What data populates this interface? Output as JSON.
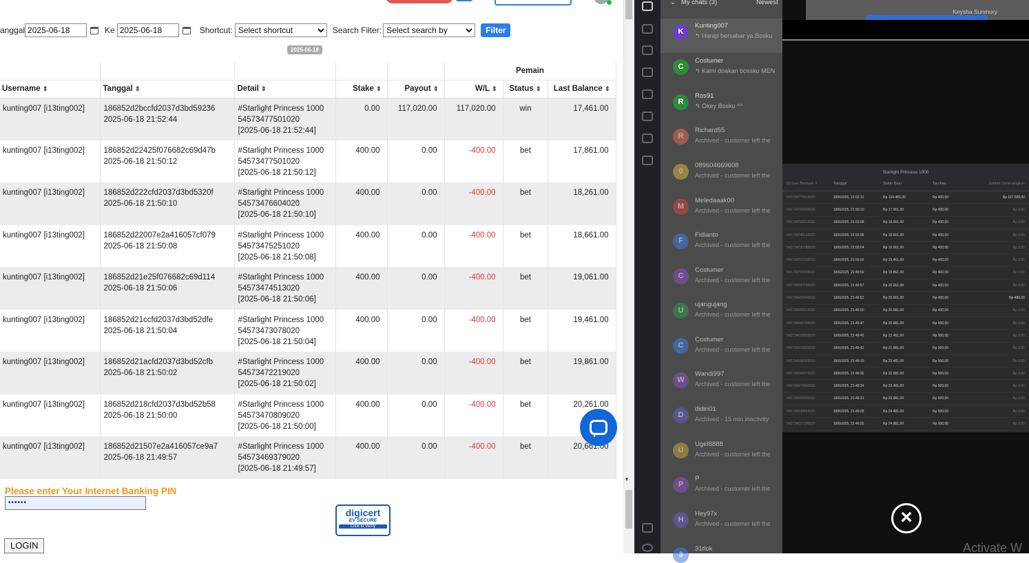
{
  "filters": {
    "date_from_label": "anggal",
    "date_from": "2025-06-18",
    "date_to_label": "Ke",
    "date_to": "2025-06-18",
    "shortcut_label": "Shortcut:",
    "shortcut_value": "Select shortcut",
    "search_filter_label": "Search Filter:",
    "search_filter_value": "Select search by",
    "filter_button": "Filter"
  },
  "date_badge": "2025-06-18",
  "table": {
    "group_header": "Pemain",
    "columns": [
      "Username",
      "Tanggal",
      "Detail",
      "Stake",
      "Payout",
      "W/L",
      "Status",
      "Last Balance"
    ],
    "rows": [
      {
        "user": "kunting007 [i13ting002]",
        "id": "186852d2bccfd2037d3bd59236",
        "ts": "2025-06-18 21:52:44",
        "game": "#Starlight Princess 1000",
        "round": "54573477501020",
        "dt": "[2025-06-18 21:52:44]",
        "stake": "0.00",
        "payout": "117,020.00",
        "wl": "117,020.00",
        "status": "win",
        "bal": "17,461.00"
      },
      {
        "user": "kunting007 [i13ting002]",
        "id": "186852d22425f076682c69d47b",
        "ts": "2025-06-18 21:50:12",
        "game": "#Starlight Princess 1000",
        "round": "54573477501020",
        "dt": "[2025-06-18 21:50:12]",
        "stake": "400.00",
        "payout": "0.00",
        "wl": "-400.00",
        "status": "bet",
        "bal": "17,861.00"
      },
      {
        "user": "kunting007 [i13ting002]",
        "id": "186852d222cfd2037d3bd5320f",
        "ts": "2025-06-18 21:50:10",
        "game": "#Starlight Princess 1000",
        "round": "54573476604020",
        "dt": "[2025-06-18 21:50:10]",
        "stake": "400.00",
        "payout": "0.00",
        "wl": "-400.00",
        "status": "bet",
        "bal": "18,261.00"
      },
      {
        "user": "kunting007 [i13ting002]",
        "id": "186852d22007e2a416057cf079",
        "ts": "2025-06-18 21:50:08",
        "game": "#Starlight Princess 1000",
        "round": "54573475251020",
        "dt": "[2025-06-18 21:50:08]",
        "stake": "400.00",
        "payout": "0.00",
        "wl": "-400.00",
        "status": "bet",
        "bal": "18,661.00"
      },
      {
        "user": "kunting007 [i13ting002]",
        "id": "186852d21e25f076682c69d114",
        "ts": "2025-06-18 21:50:06",
        "game": "#Starlight Princess 1000",
        "round": "54573474513020",
        "dt": "[2025-06-18 21:50:06]",
        "stake": "400.00",
        "payout": "0.00",
        "wl": "-400.00",
        "status": "bet",
        "bal": "19,061.00"
      },
      {
        "user": "kunting007 [i13ting002]",
        "id": "186852d21ccfd2037d3bd52dfe",
        "ts": "2025-06-18 21:50:04",
        "game": "#Starlight Princess 1000",
        "round": "54573473078020",
        "dt": "[2025-06-18 21:50:04]",
        "stake": "400.00",
        "payout": "0.00",
        "wl": "-400.00",
        "status": "bet",
        "bal": "19,461.00"
      },
      {
        "user": "kunting007 [i13ting002]",
        "id": "186852d21acfd2037d3bd52cfb",
        "ts": "2025-06-18 21:50:02",
        "game": "#Starlight Princess 1000",
        "round": "54573472219020",
        "dt": "[2025-06-18 21:50:02]",
        "stake": "400.00",
        "payout": "0.00",
        "wl": "-400.00",
        "status": "bet",
        "bal": "19,861.00"
      },
      {
        "user": "kunting007 [i13ting002]",
        "id": "186852d218cfd2037d3bd52b58",
        "ts": "2025-06-18 21:50:00",
        "game": "#Starlight Princess 1000",
        "round": "54573470809020",
        "dt": "[2025-06-18 21:50:00]",
        "stake": "400.00",
        "payout": "0.00",
        "wl": "-400.00",
        "status": "bet",
        "bal": "20,261.00"
      },
      {
        "user": "kunting007 [i13ting002]",
        "id": "186852d21507e2a416057ce9a7",
        "ts": "2025-06-18 21:49:57",
        "game": "#Starlight Princess 1000",
        "round": "54573469379020",
        "dt": "[2025-06-18 21:49:57]",
        "stake": "400.00",
        "payout": "0.00",
        "wl": "-400.00",
        "status": "bet",
        "bal": "20,661.00"
      }
    ]
  },
  "bottom": {
    "pin_label": "Please enter Your Internet Banking PIN",
    "pin_value": "••••••",
    "login_button": "LOGIN",
    "digicert_logo": "digicert",
    "digicert_ev": "EV SECURE",
    "digicert_verify": "Click to Verify"
  },
  "chat": {
    "list_title": "My chats (3)",
    "sort": "Newest",
    "agent_name": "Keysha Sunmory",
    "items": [
      {
        "initial": "K",
        "name": "Kunting007",
        "msg": "↰ Harap bersabar ya Bosku",
        "color": "#6a3fc4"
      },
      {
        "initial": "C",
        "name": "Costumer",
        "msg": "↰ Kami doakan bossku MEN",
        "color": "#2e8b3a"
      },
      {
        "initial": "R",
        "name": "Ros91",
        "msg": "↰ Okey Bosku ^^",
        "color": "#2e8b3a"
      },
      {
        "initial": "R",
        "name": "Richard55",
        "msg": "Archived - customer left the",
        "color": "#e56b4f"
      },
      {
        "initial": "0",
        "name": "089604669608",
        "msg": "Archived - customer left the",
        "color": "#d8b13a"
      },
      {
        "initial": "M",
        "name": "Meledaaak00",
        "msg": "Archived - customer left the",
        "color": "#d84545"
      },
      {
        "initial": "F",
        "name": "Fidianto",
        "msg": "Archived - customer left the",
        "color": "#3b7de0"
      },
      {
        "initial": "C",
        "name": "Costumer",
        "msg": "Archived - customer left the",
        "color": "#8e4fc4"
      },
      {
        "initial": "U",
        "name": "ujangujang",
        "msg": "Archived - customer left the",
        "color": "#2e9b4a"
      },
      {
        "initial": "C",
        "name": "Costumer",
        "msg": "Archived - customer left the",
        "color": "#3b7de0"
      },
      {
        "initial": "W",
        "name": "Wandi997",
        "msg": "Archived - customer left the",
        "color": "#8e4fc4"
      },
      {
        "initial": "D",
        "name": "didin01",
        "msg": "Archived - 15 min inactivity",
        "color": "#6a5fc4"
      },
      {
        "initial": "U",
        "name": "Ugel8888",
        "msg": "Archived - customer left the",
        "color": "#c7a43a"
      },
      {
        "initial": "P",
        "name": "P",
        "msg": "Archived - customer left the",
        "color": "#8e4fc4"
      },
      {
        "initial": "H",
        "name": "Hey97x",
        "msg": "Archived - customer left the",
        "color": "#6a5fc4"
      },
      {
        "initial": "3",
        "name": "31tlok",
        "msg": "",
        "color": "#3b7de0"
      }
    ]
  },
  "preview": {
    "title": "Starlight Princess 1000",
    "headers": [
      "ID Sesi Bermain #",
      "Tanggal",
      "Saldo Baru",
      "Taruhan",
      "Jumlah Dimenangkan"
    ],
    "rows": [
      [
        "545734775010020",
        "18/6/2025, 21:52:12",
        "Rp 134.481,00",
        "Rp 400,00",
        "Rp 117.020,00"
      ],
      [
        "545734766040020",
        "18/6/2025, 21:50:10",
        "Rp 17.861,00",
        "Rp 400,00",
        "Rp 0,00"
      ],
      [
        "545734752510020",
        "18/6/2025, 21:50:08",
        "Rp 18.261,00",
        "Rp 400,00",
        "Rp 0,00"
      ],
      [
        "545734745130020",
        "18/6/2025, 21:50:06",
        "Rp 18.661,00",
        "Rp 400,00",
        "Rp 0,00"
      ],
      [
        "545734730780020",
        "18/6/2025, 21:50:04",
        "Rp 19.061,00",
        "Rp 400,00",
        "Rp 0,00"
      ],
      [
        "545734722190020",
        "18/6/2025, 21:50:02",
        "Rp 19.461,00",
        "Rp 400,00",
        "Rp 0,00"
      ],
      [
        "545734708090020",
        "18/6/2025, 21:49:59",
        "Rp 19.861,00",
        "Rp 400,00",
        "Rp 0,00"
      ],
      [
        "545734693790020",
        "18/6/2025, 21:49:57",
        "Rp 20.261,00",
        "Rp 400,00",
        "Rp 0,00"
      ],
      [
        "545734669940020",
        "18/6/2025, 21:49:52",
        "Rp 20.661,00",
        "Rp 400,00",
        "Rp 480,00"
      ],
      [
        "545734655610020",
        "18/6/2025, 21:49:50",
        "Rp 20.581,00",
        "Rp 400,00",
        "Rp 0,00"
      ],
      [
        "545734642700020",
        "18/6/2025, 21:49:47",
        "Rp 20.981,00",
        "Rp 500,00",
        "Rp 0,00"
      ],
      [
        "545734628900020",
        "18/6/2025, 21:49:45",
        "Rp 21.481,00",
        "Rp 500,00",
        "Rp 0,00"
      ],
      [
        "545734613620020",
        "18/6/2025, 21:49:42",
        "Rp 21.981,00",
        "Rp 500,00",
        "Rp 0,00"
      ],
      [
        "545734598300020",
        "18/6/2025, 21:49:39",
        "Rp 22.481,00",
        "Rp 500,00",
        "Rp 0,00"
      ],
      [
        "545734584070020",
        "18/6/2025, 21:49:36",
        "Rp 22.981,00",
        "Rp 500,00",
        "Rp 0,00"
      ],
      [
        "545734570930020",
        "18/6/2025, 21:49:34",
        "Rp 23.481,00",
        "Rp 500,00",
        "Rp 0,00"
      ],
      [
        "545734555590020",
        "18/6/2025, 21:49:31",
        "Rp 23.981,00",
        "Rp 500,00",
        "Rp 0,00"
      ],
      [
        "545734538550020",
        "18/6/2025, 21:49:28",
        "Rp 24.481,00",
        "Rp 500,00",
        "Rp 0,00"
      ],
      [
        "545734527230020",
        "18/6/2025, 21:49:26",
        "Rp 24.981,00",
        "Rp 500,00",
        "Rp 0,00"
      ]
    ]
  },
  "watermark": "Activate W"
}
